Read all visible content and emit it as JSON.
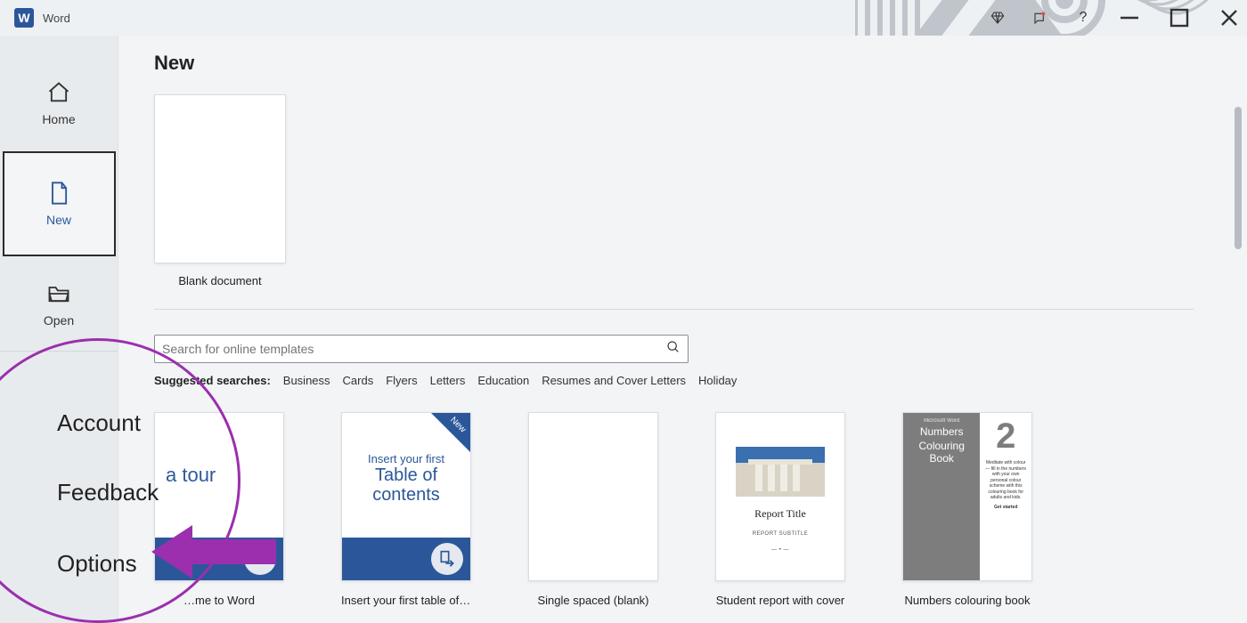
{
  "titlebar": {
    "app_name": "Word"
  },
  "window_buttons": {
    "help": "?"
  },
  "sidebar": {
    "items": [
      {
        "label": "Home"
      },
      {
        "label": "New"
      },
      {
        "label": "Open"
      }
    ]
  },
  "annotation_menu": {
    "account": "Account",
    "feedback": "Feedback",
    "options": "Options"
  },
  "main": {
    "heading": "New",
    "blank_label": "Blank document",
    "search_placeholder": "Search for online templates",
    "suggested_lead": "Suggested searches:",
    "suggested": [
      "Business",
      "Cards",
      "Flyers",
      "Letters",
      "Education",
      "Resumes and Cover Letters",
      "Holiday"
    ],
    "templates": [
      {
        "caption": "…me to Word",
        "thumb_text": "a tour"
      },
      {
        "caption": "Insert your first table of c…",
        "ribbon": "New",
        "thumb_line1": "Insert your first",
        "thumb_line2a": "Table of",
        "thumb_line2b": "contents"
      },
      {
        "caption": "Single spaced (blank)"
      },
      {
        "caption": "Student report with cover",
        "thumb_title": "Report Title",
        "thumb_sub": "Report subtitle"
      },
      {
        "caption": "Numbers colouring book",
        "left_top": "Microsoft Word",
        "left_title1": "Numbers",
        "left_title2": "Colouring Book",
        "big": "2",
        "tiny1": "Meditate with colour — fill in the numbers with your own personal colour scheme with this colouring book for adults and kids.",
        "tiny2": "Get started"
      }
    ]
  }
}
